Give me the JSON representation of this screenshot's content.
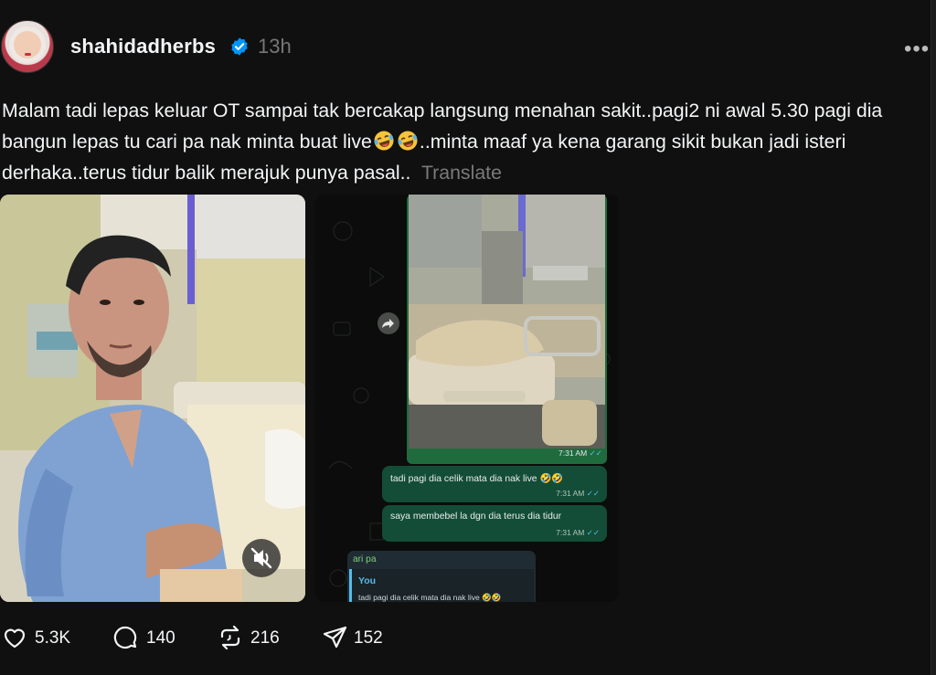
{
  "post": {
    "username": "shahidadherbs",
    "time_ago": "13h",
    "more_label": "•••",
    "caption_part1": "Malam tadi lepas keluar OT sampai tak bercakap langsung menahan sakit..pagi2 ni awal 5.30 pagi dia bangun lepas tu cari pa nak minta buat live",
    "caption_part2": "..minta maaf ya kena garang sikit bukan jadi isteri derhaka..terus tidur balik merajuk punya pasal..",
    "translate_label": "Translate"
  },
  "chat": {
    "photo_time": "7:31 AM",
    "messages": [
      {
        "text": "tadi pagi dia celik mata dia nak live",
        "time": "7:31 AM"
      },
      {
        "text": "saya membebel la dgn dia terus dia tidur",
        "time": "7:31 AM"
      }
    ],
    "reply_sender": "ari pa",
    "quote_name": "You",
    "quote_text": "tadi pagi dia celik mata dia nak live"
  },
  "actions": {
    "likes": "5.3K",
    "comments": "140",
    "reposts": "216",
    "shares": "152"
  },
  "icons": [
    "verified-badge-icon",
    "more-icon",
    "laughing-emoji-icon",
    "mute-icon",
    "share-arrow-icon",
    "heart-icon",
    "comment-icon",
    "repost-icon",
    "send-icon",
    "double-check-icon"
  ],
  "colors": {
    "background": "#101010",
    "verified": "#0095f6",
    "chat_bubble": "#134d37",
    "muted_text": "#777777"
  }
}
